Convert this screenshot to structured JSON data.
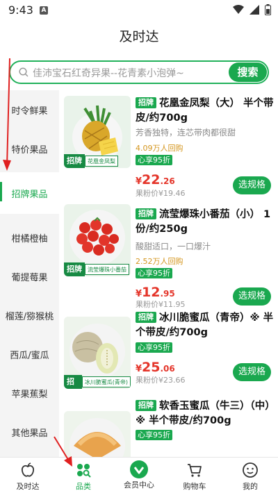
{
  "status_bar": {
    "time": "9:43",
    "a_icon": "A"
  },
  "page_title": "及时达",
  "search": {
    "placeholder": "佳沛宝石红奇异果--花青素小泡弹~",
    "button": "搜索"
  },
  "sidebar": {
    "items": [
      {
        "label": "时令鲜果"
      },
      {
        "label": "特价果品"
      },
      {
        "label": "招牌果品"
      },
      {
        "label": "柑橘橙柚"
      },
      {
        "label": "葡提莓果"
      },
      {
        "label": "榴莲/猕猴桃"
      },
      {
        "label": "西瓜/蜜瓜"
      },
      {
        "label": "苹果蕉梨"
      },
      {
        "label": "其他果品"
      }
    ],
    "active_index": 2
  },
  "badge_label": "招牌",
  "products": [
    {
      "title": "花凰金凤梨（大） 半个带皮/约700g",
      "description": "芳香独特，连芯带肉都很甜",
      "sold": "4.09万人回购",
      "discount": "心享95折",
      "price_yen": "¥",
      "price_int": "22",
      "price_dec": ".26",
      "market_price": "果粉价¥19.46",
      "button": "选规格",
      "thumb_caption": "花凰金凤梨"
    },
    {
      "title": "流莹爆珠小番茄（小） 1份/约250g",
      "description": "酸甜适口，一口爆汁",
      "sold": "2.52万人回购",
      "discount": "心享95折",
      "price_yen": "¥",
      "price_int": "12",
      "price_dec": ".95",
      "market_price": "果粉价¥11.95",
      "button": "选规格",
      "thumb_caption": "流莹爆珠小番茄"
    },
    {
      "title": "冰川脆蜜瓜（青帝）※ 半个带皮/约700g",
      "description": "",
      "sold": "",
      "discount": "心享95折",
      "price_yen": "¥",
      "price_int": "25",
      "price_dec": ".06",
      "market_price": "果粉价¥23.66",
      "button": "选规格",
      "thumb_caption": "冰川脆蜜瓜(青帝)"
    },
    {
      "title": "软香玉蜜瓜（牛三）（中）※ 半个带皮/约700g",
      "description": "",
      "sold": "",
      "discount": "心享95折",
      "price_yen": "",
      "price_int": "",
      "price_dec": "",
      "market_price": "",
      "button": "",
      "thumb_caption": ""
    }
  ],
  "bottom_nav": [
    {
      "label": "及时达",
      "icon": "apple-icon"
    },
    {
      "label": "品类",
      "icon": "category-icon"
    },
    {
      "label": "会员中心",
      "icon": "member-icon"
    },
    {
      "label": "购物车",
      "icon": "cart-icon"
    },
    {
      "label": "我的",
      "icon": "profile-icon"
    }
  ],
  "colors": {
    "accent": "#1aa84f",
    "price": "#e4352a",
    "sold": "#d4961f",
    "annotation_arrow": "#e02020"
  }
}
